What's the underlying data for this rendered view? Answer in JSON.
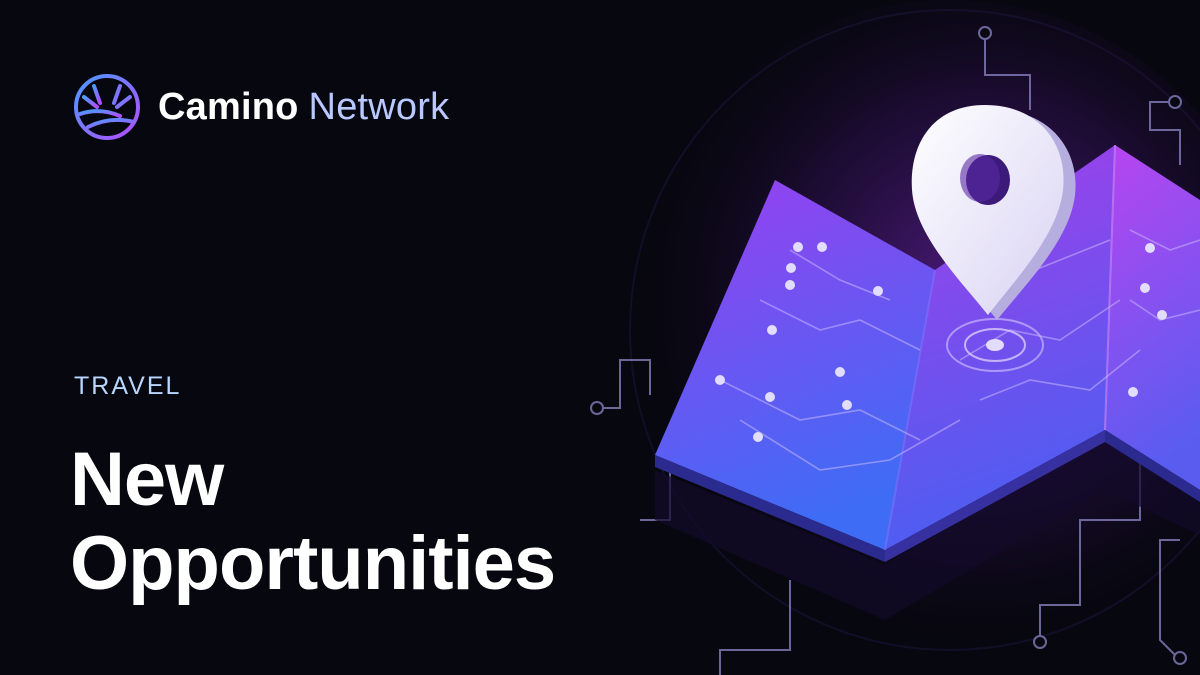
{
  "brand": {
    "name_primary": "Camino",
    "name_secondary": "Network",
    "logo_icon": "camino-sun-logo-icon"
  },
  "category": "TRAVEL",
  "headline": {
    "line1": "New",
    "line2": "Opportunities"
  },
  "illustration": {
    "icons": [
      "map-pin-icon",
      "folded-map-icon",
      "circuit-lines-icon"
    ]
  },
  "colors": {
    "background": "#07070f",
    "accent_purple": "#9b3df2",
    "accent_blue": "#4a5cf0",
    "label_blue": "#b9d6ff"
  }
}
